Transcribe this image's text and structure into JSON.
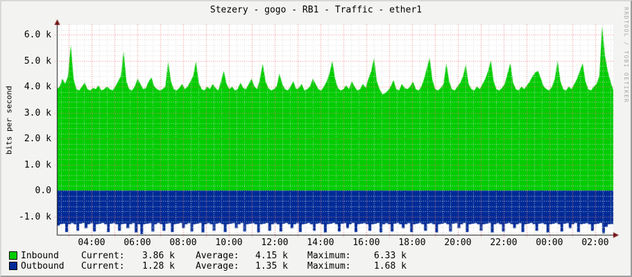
{
  "title": "Stezery - gogo - RB1 - Traffic - ether1",
  "y_axis_label": "bits per second",
  "watermark": "RRDTOOL / TOBI OETIKER",
  "legend": {
    "columns": {
      "current": "Current:",
      "average": "Average:",
      "maximum": "Maximum:"
    },
    "rows": [
      {
        "name": "Inbound",
        "color": "#00CC00",
        "current": "3.86 k",
        "average": "4.15 k",
        "maximum": "6.33 k"
      },
      {
        "name": "Outbound",
        "color": "#002A97",
        "current": "1.28 k",
        "average": "1.35 k",
        "maximum": "1.68 k"
      }
    ]
  },
  "colors": {
    "outer_background": "#f3f3f1",
    "plot_background": "#ffffff",
    "major_grid": "rgba(255,70,70,0.6)",
    "minor_grid": "rgba(214,214,214,0.9)",
    "axis": "#1b1b1b",
    "arrow": "#731414",
    "watermark_text": "#aaaaaa"
  },
  "chart_data": {
    "type": "area",
    "title": "Stezery - gogo - RB1 - Traffic - ether1",
    "xlabel": "",
    "ylabel": "bits per second",
    "unit": "kbit/s",
    "ylim_k": [
      -1.68,
      6.4
    ],
    "y_ticks": [
      "6.0 k",
      "5.0 k",
      "4.0 k",
      "3.0 k",
      "2.0 k",
      "1.0 k",
      "0.0",
      "-1.0 k"
    ],
    "y_tick_values_k": [
      6,
      5,
      4,
      3,
      2,
      1,
      0,
      -1
    ],
    "x_ticks": [
      "04:00",
      "06:00",
      "08:00",
      "10:00",
      "12:00",
      "14:00",
      "16:00",
      "18:00",
      "20:00",
      "22:00",
      "00:00",
      "02:00"
    ],
    "grid": {
      "x_minor_minutes": 20,
      "x_major_minutes": 60,
      "y_minor_k": 0.2,
      "y_major_k": 1.0
    },
    "legend_position": "bottom",
    "series": [
      {
        "name": "Inbound",
        "color": "#00CC00",
        "render": "area",
        "stats_k": {
          "current": 3.86,
          "average": 4.15,
          "maximum": 6.33
        },
        "values_k": [
          3.9,
          4.0,
          4.3,
          4.1,
          4.4,
          5.6,
          4.3,
          3.9,
          3.85,
          4.0,
          4.15,
          3.9,
          3.85,
          3.95,
          3.9,
          4.05,
          3.85,
          3.9,
          4.0,
          3.9,
          3.85,
          4.0,
          4.2,
          4.4,
          5.35,
          4.2,
          3.9,
          3.85,
          4.0,
          4.3,
          4.1,
          3.9,
          3.95,
          4.2,
          4.35,
          4.0,
          3.9,
          3.85,
          3.9,
          4.0,
          4.97,
          4.2,
          3.9,
          3.85,
          3.95,
          4.1,
          3.9,
          4.0,
          4.2,
          4.4,
          4.97,
          4.15,
          3.9,
          3.85,
          4.0,
          3.9,
          4.1,
          3.95,
          3.85,
          4.2,
          4.6,
          4.1,
          3.9,
          4.0,
          3.85,
          3.9,
          4.15,
          3.95,
          3.9,
          4.1,
          4.3,
          4.0,
          3.9,
          4.3,
          4.88,
          4.2,
          3.95,
          3.85,
          3.9,
          4.0,
          4.5,
          4.1,
          3.9,
          3.85,
          4.0,
          4.2,
          3.9,
          3.95,
          4.1,
          3.85,
          3.9,
          4.0,
          4.3,
          4.1,
          3.9,
          3.85,
          4.0,
          4.2,
          4.5,
          4.99,
          4.3,
          3.95,
          3.85,
          3.9,
          4.05,
          3.9,
          4.2,
          4.0,
          3.85,
          3.9,
          4.1,
          3.95,
          4.3,
          4.6,
          5.1,
          4.2,
          3.9,
          3.7,
          3.75,
          3.85,
          4.0,
          4.25,
          3.9,
          3.85,
          4.1,
          3.95,
          3.9,
          4.0,
          4.2,
          3.9,
          3.85,
          4.0,
          4.3,
          4.7,
          5.1,
          4.25,
          3.9,
          3.85,
          3.95,
          4.1,
          4.9,
          4.2,
          3.9,
          3.85,
          4.0,
          4.15,
          4.4,
          4.85,
          4.1,
          3.9,
          3.85,
          4.0,
          3.9,
          4.1,
          4.3,
          4.6,
          5.0,
          4.2,
          3.9,
          3.85,
          3.95,
          4.1,
          4.5,
          4.9,
          4.15,
          3.9,
          3.85,
          4.0,
          3.9,
          4.05,
          4.2,
          4.4,
          4.55,
          4.6,
          4.3,
          4.0,
          3.9,
          3.85,
          4.0,
          4.3,
          5.0,
          4.2,
          3.9,
          3.85,
          4.0,
          3.9,
          4.1,
          4.3,
          4.6,
          4.9,
          4.2,
          3.9,
          3.85,
          4.0,
          4.1,
          4.4,
          6.33,
          5.2,
          4.6,
          4.2,
          3.86
        ]
      },
      {
        "name": "Outbound",
        "color": "#002A97",
        "render": "area-mirrored-step",
        "stats_k": {
          "current": 1.28,
          "average": 1.35,
          "maximum": 1.68
        },
        "values_k": [
          1.35,
          1.3,
          1.28,
          1.6,
          1.3,
          1.26,
          1.3,
          1.55,
          1.28,
          1.25,
          1.45,
          1.3,
          1.26,
          1.58,
          1.3,
          1.28,
          1.25,
          1.3,
          1.6,
          1.28,
          1.26,
          1.3,
          1.55,
          1.3,
          1.28,
          1.45,
          1.3,
          1.26,
          1.62,
          1.3,
          1.68,
          1.3,
          1.28,
          1.26,
          1.58,
          1.3,
          1.25,
          1.3,
          1.55,
          1.28,
          1.26,
          1.6,
          1.3,
          1.28,
          1.25,
          1.45,
          1.3,
          1.26,
          1.58,
          1.3,
          1.28,
          1.25,
          1.62,
          1.3,
          1.26,
          1.3,
          1.55,
          1.28,
          1.25,
          1.3,
          1.6,
          1.3,
          1.28,
          1.26,
          1.45,
          1.3,
          1.25,
          1.58,
          1.3,
          1.28,
          1.26,
          1.3,
          1.62,
          1.3,
          1.28,
          1.25,
          1.55,
          1.3,
          1.26,
          1.3,
          1.58,
          1.28,
          1.25,
          1.3,
          1.45,
          1.3,
          1.26,
          1.6,
          1.3,
          1.28,
          1.25,
          1.3,
          1.55,
          1.28,
          1.26,
          1.3,
          1.62,
          1.3,
          1.28,
          1.25,
          1.3,
          1.58,
          1.28,
          1.26,
          1.45,
          1.3,
          1.25,
          1.6,
          1.3,
          1.28,
          1.26,
          1.3,
          1.55,
          1.3,
          1.28,
          1.25,
          1.62,
          1.3,
          1.26,
          1.3,
          1.58,
          1.28,
          1.25,
          1.3,
          1.45,
          1.3,
          1.26,
          1.6,
          1.3,
          1.28,
          1.25,
          1.3,
          1.55,
          1.28,
          1.26,
          1.3,
          1.62,
          1.3,
          1.28,
          1.25,
          1.3,
          1.58,
          1.28,
          1.26,
          1.45,
          1.3,
          1.25,
          1.6,
          1.3,
          1.28,
          1.26,
          1.3,
          1.55,
          1.3,
          1.28,
          1.25,
          1.62,
          1.3,
          1.26,
          1.3,
          1.58,
          1.28,
          1.25,
          1.3,
          1.45,
          1.3,
          1.26,
          1.6,
          1.3,
          1.28,
          1.25,
          1.3,
          1.55,
          1.28,
          1.26,
          1.3,
          1.62,
          1.3,
          1.28,
          1.25,
          1.3,
          1.58,
          1.28,
          1.26,
          1.45,
          1.3,
          1.25,
          1.6,
          1.3,
          1.28,
          1.26,
          1.3,
          1.55,
          1.3,
          1.28,
          1.25,
          1.65,
          1.4,
          1.3,
          1.29,
          1.28
        ]
      }
    ]
  }
}
